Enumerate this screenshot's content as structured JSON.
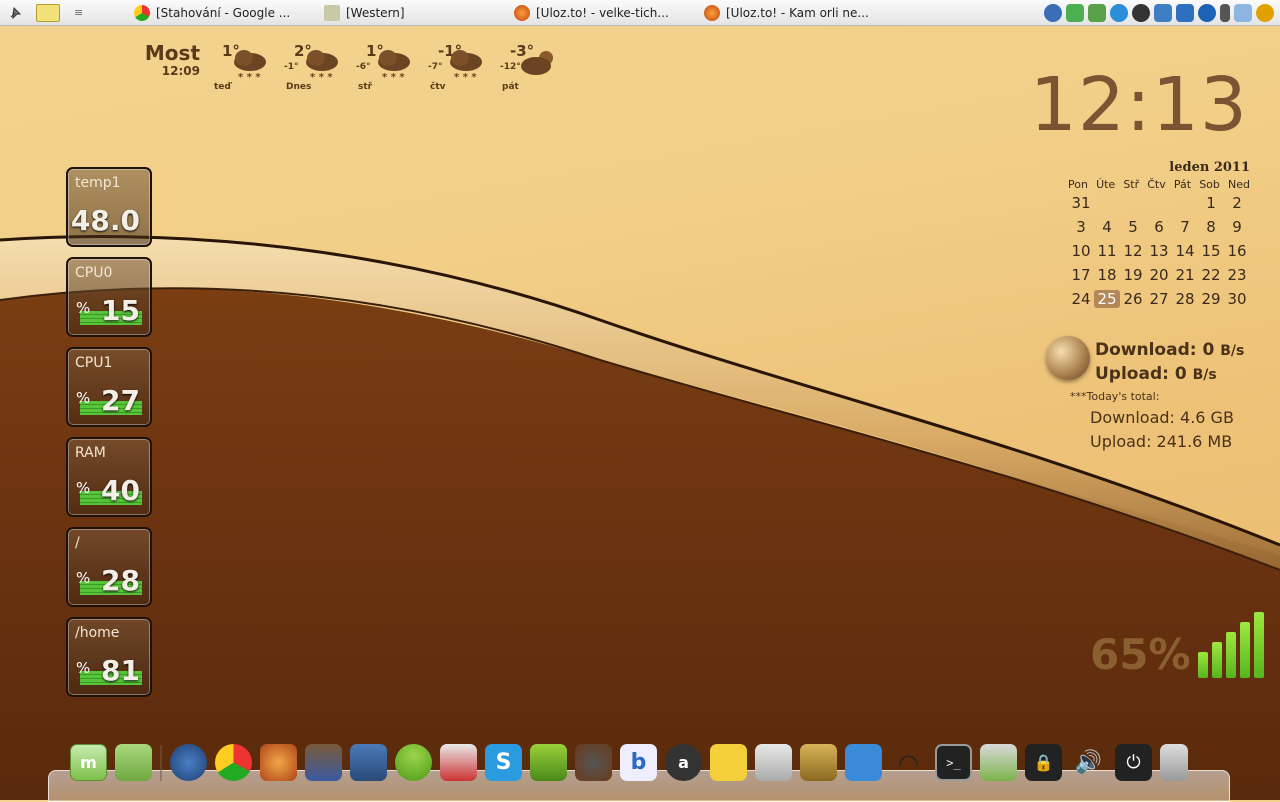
{
  "topbar": {
    "tasks": [
      {
        "label": "[Stahování - Google ...",
        "icon": "chrome-icon"
      },
      {
        "label": "[Western]",
        "icon": "folder-icon"
      },
      {
        "label": "[Uloz.to! - velke-tich...",
        "icon": "firefox-icon"
      },
      {
        "label": "[Uloz.to! - Kam orli ne...",
        "icon": "firefox-icon"
      }
    ],
    "tray_icons": [
      "thunderbird-icon",
      "shield-icon",
      "update-icon",
      "skype-icon",
      "user-icon",
      "dropbox-icon",
      "accessibility-icon",
      "hp-icon",
      "battery-icon",
      "drive-icon",
      "search-icon"
    ]
  },
  "weather": {
    "location": "Most",
    "time": "12:09",
    "days": [
      {
        "name": "teď",
        "high": "1°",
        "low": "",
        "icon": "snow-cloud-icon"
      },
      {
        "name": "Dnes",
        "high": "2°",
        "low": "-1°",
        "icon": "snow-cloud-icon"
      },
      {
        "name": "stř",
        "high": "1°",
        "low": "-6°",
        "icon": "snow-cloud-icon"
      },
      {
        "name": "čtv",
        "high": "-1°",
        "low": "-7°",
        "icon": "snow-cloud-icon"
      },
      {
        "name": "pát",
        "high": "-3°",
        "low": "-12°",
        "icon": "sun-cloud-icon"
      }
    ]
  },
  "sensors": [
    {
      "label": "temp1",
      "value": "48.0",
      "percent": false,
      "level": null
    },
    {
      "label": "CPU0",
      "value": "15",
      "percent": true,
      "level": 15
    },
    {
      "label": "CPU1",
      "value": "27",
      "percent": true,
      "level": 27
    },
    {
      "label": "RAM",
      "value": "40",
      "percent": true,
      "level": 40
    },
    {
      "label": "/",
      "value": "28",
      "percent": true,
      "level": 28
    },
    {
      "label": "/home",
      "value": "81",
      "percent": true,
      "level": 81
    }
  ],
  "percent_sign": "%",
  "clock": {
    "time": "12:13"
  },
  "calendar": {
    "title": "leden 2011",
    "day_headers": [
      "Pon",
      "Úte",
      "Stř",
      "Čtv",
      "Pát",
      "Sob",
      "Ned"
    ],
    "weeks": [
      [
        "31",
        "",
        "",
        "",
        "",
        "1",
        "2"
      ],
      [
        "3",
        "4",
        "5",
        "6",
        "7",
        "8",
        "9"
      ],
      [
        "10",
        "11",
        "12",
        "13",
        "14",
        "15",
        "16"
      ],
      [
        "17",
        "18",
        "19",
        "20",
        "21",
        "22",
        "23"
      ],
      [
        "24",
        "25",
        "26",
        "27",
        "28",
        "29",
        "30"
      ]
    ],
    "today": "25"
  },
  "network": {
    "download_label": "Download: 0",
    "upload_label": "Upload: 0",
    "unit": "B/s",
    "today_label": "***Today's total:",
    "total_download": "Download: 4.6 GB",
    "total_upload": "Upload: 241.6 MB"
  },
  "battery": {
    "percent_text": "65%",
    "level": 65
  },
  "dock": {
    "icons": [
      "mint-menu-icon",
      "files-icon",
      "thunderbird-icon",
      "chrome-icon",
      "webcam-icon",
      "contacts-icon",
      "mail-icon",
      "chat-icon",
      "rocket-icon",
      "skype-icon",
      "phone-icon",
      "speaker-icon",
      "blogger-icon",
      "amule-icon",
      "cheese-icon",
      "calculator-icon",
      "spy-icon",
      "pointer-icon",
      "wifi-icon",
      "terminal-icon",
      "monitor-icon",
      "lock-icon",
      "volume-icon",
      "power-icon",
      "trash-icon"
    ]
  }
}
